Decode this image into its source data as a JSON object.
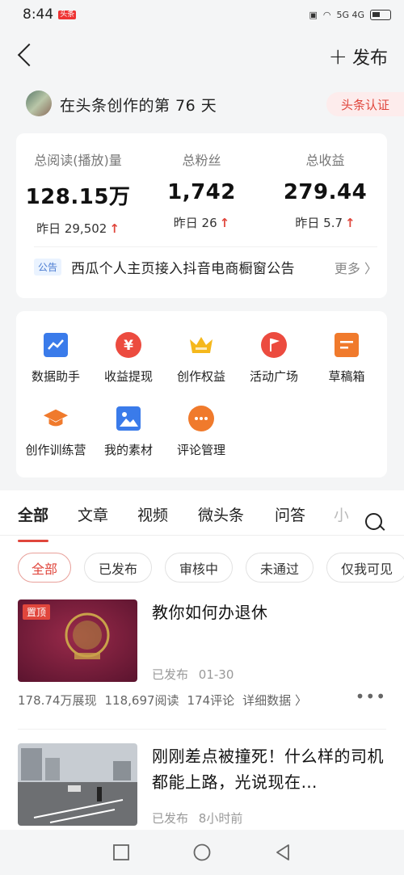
{
  "status_bar": {
    "time": "8:44",
    "badge": "头条",
    "signal": "5G 4G"
  },
  "header": {
    "publish_label": "发布"
  },
  "user": {
    "days_text": "在头条创作的第 76 天",
    "verify_label": "头条认证"
  },
  "stats": [
    {
      "label": "总阅读(播放)量",
      "value": "128.15万",
      "yesterday": "昨日 29,502"
    },
    {
      "label": "总粉丝",
      "value": "1,742",
      "yesterday": "昨日 26"
    },
    {
      "label": "总收益",
      "value": "279.44",
      "yesterday": "昨日 5.7"
    }
  ],
  "notice": {
    "tag": "公告",
    "text": "西瓜个人主页接入抖音电商橱窗公告",
    "more": "更多 〉"
  },
  "tools": [
    {
      "label": "数据助手",
      "icon": "chart-icon",
      "color": "#3a7bea"
    },
    {
      "label": "收益提现",
      "icon": "yuan-icon",
      "color": "#ec4b3f"
    },
    {
      "label": "创作权益",
      "icon": "crown-icon",
      "color": "#f5b81c"
    },
    {
      "label": "活动广场",
      "icon": "flag-icon",
      "color": "#ec4b3f"
    },
    {
      "label": "草稿箱",
      "icon": "draft-icon",
      "color": "#f07a2c"
    },
    {
      "label": "创作训练营",
      "icon": "graduation-cap-icon",
      "color": "#f07a2c"
    },
    {
      "label": "我的素材",
      "icon": "image-icon",
      "color": "#3a7bea"
    },
    {
      "label": "评论管理",
      "icon": "comment-icon",
      "color": "#f07a2c"
    }
  ],
  "tabs": [
    "全部",
    "文章",
    "视频",
    "微头条",
    "问答",
    "小"
  ],
  "chips": [
    "全部",
    "已发布",
    "审核中",
    "未通过",
    "仅我可见"
  ],
  "articles": [
    {
      "title": "教你如何办退休",
      "pin": "置顶",
      "status": "已发布",
      "date": "01-30",
      "stats": [
        "178.74万展现",
        "118,697阅读",
        "174评论",
        "详细数据 〉"
      ]
    },
    {
      "title": "刚刚差点被撞死！什么样的司机都能上路，光说现在…",
      "status": "已发布",
      "date": "8小时前"
    }
  ]
}
